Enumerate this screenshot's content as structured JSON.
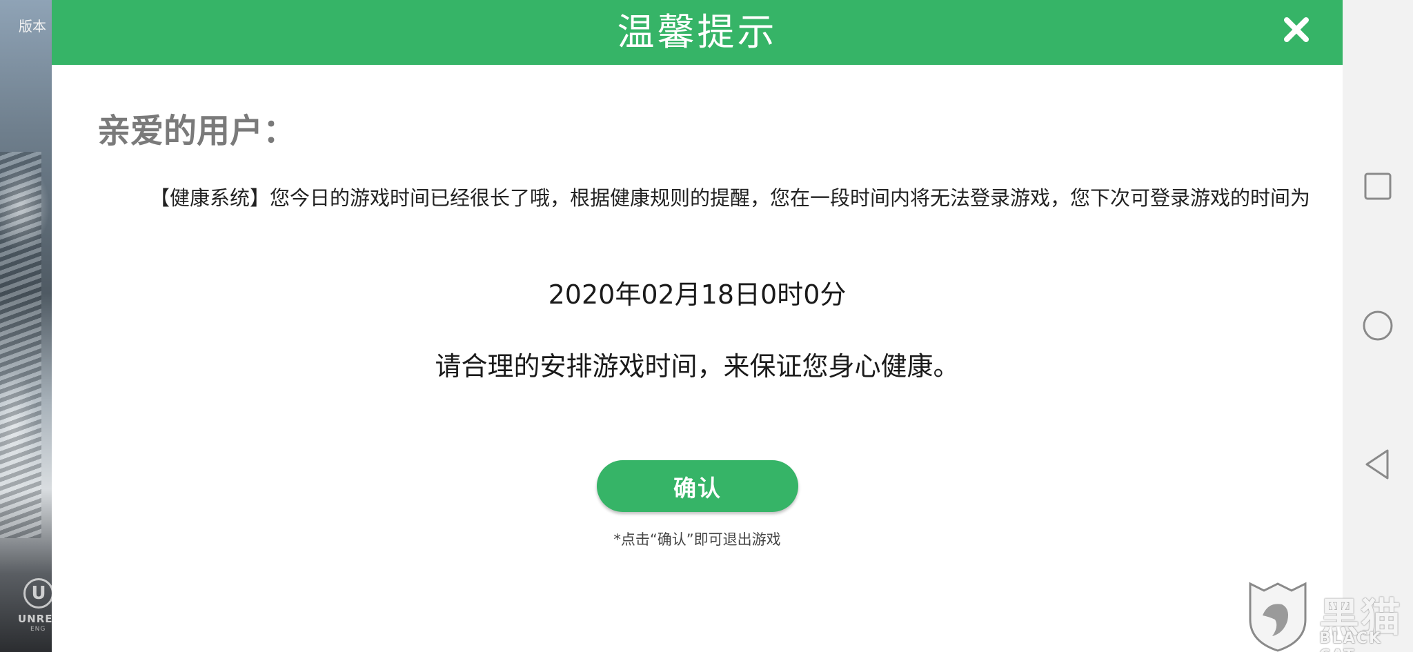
{
  "background": {
    "version_label": "版本",
    "engine_logo_letter": "U",
    "engine_name": "UNRE",
    "engine_sub": "ENG"
  },
  "dialog": {
    "title": "温馨提示",
    "close_icon": "close-icon",
    "greeting": "亲爱的用户：",
    "message": "【健康系统】您今日的游戏时间已经很长了哦，根据健康规则的提醒，您在一段时间内将无法登录游戏，您下次可登录游戏的时间为",
    "unlock_time": "2020年02月18日0时0分",
    "advice": "请合理的安排游戏时间，来保证您身心健康。",
    "confirm_label": "确认",
    "confirm_note": "*点击“确认”即可退出游戏"
  },
  "nav_bar": {
    "items": [
      "recent-apps-icon",
      "home-icon",
      "back-icon"
    ]
  },
  "watermark": {
    "cn": "黑猫",
    "en": "BLACK CAT"
  },
  "colors": {
    "accent": "#36b467",
    "text": "#222222",
    "greeting": "#7a7a7a",
    "nav_bg": "#f2f2f2"
  }
}
